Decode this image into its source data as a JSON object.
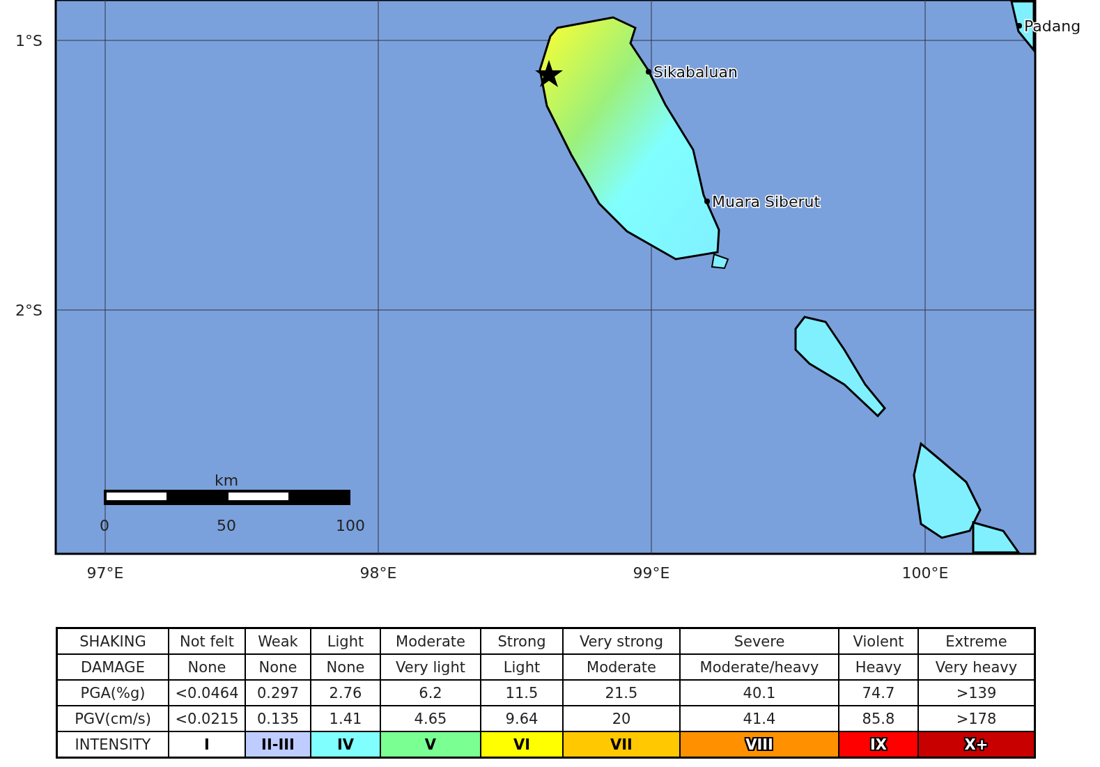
{
  "map": {
    "lat_labels": [
      "1°S",
      "2°S"
    ],
    "lon_labels": [
      "97°E",
      "98°E",
      "99°E",
      "100°E"
    ],
    "cities": [
      {
        "name": "Padang"
      },
      {
        "name": "Sikabaluan"
      },
      {
        "name": "Muara Siberut"
      }
    ],
    "scale_bar": {
      "unit": "km",
      "ticks": [
        "0",
        "50",
        "100"
      ]
    }
  },
  "legend": {
    "rows": [
      {
        "kind": "text",
        "header": "SHAKING",
        "cells": [
          "Not felt",
          "Weak",
          "Light",
          "Moderate",
          "Strong",
          "Very strong",
          "Severe",
          "Violent",
          "Extreme"
        ]
      },
      {
        "kind": "text",
        "header": "DAMAGE",
        "cells": [
          "None",
          "None",
          "None",
          "Very light",
          "Light",
          "Moderate",
          "Moderate/heavy",
          "Heavy",
          "Very heavy"
        ]
      },
      {
        "kind": "text",
        "header": "PGA(%g)",
        "cells": [
          "<0.0464",
          "0.297",
          "2.76",
          "6.2",
          "11.5",
          "21.5",
          "40.1",
          "74.7",
          ">139"
        ]
      },
      {
        "kind": "text",
        "header": "PGV(cm/s)",
        "cells": [
          "<0.0215",
          "0.135",
          "1.41",
          "4.65",
          "9.64",
          "20",
          "41.4",
          "85.8",
          ">178"
        ]
      },
      {
        "kind": "intensity",
        "header": "INTENSITY",
        "cells": [
          {
            "label": "I",
            "color": "#ffffff"
          },
          {
            "label": "II-III",
            "color": "#bfccff"
          },
          {
            "label": "IV",
            "color": "#80ffff"
          },
          {
            "label": "V",
            "color": "#7aff93"
          },
          {
            "label": "VI",
            "color": "#ffff00"
          },
          {
            "label": "VII",
            "color": "#ffc800"
          },
          {
            "label": "VIII",
            "color": "#ff9100"
          },
          {
            "label": "IX",
            "color": "#ff0000"
          },
          {
            "label": "X+",
            "color": "#c80000"
          }
        ]
      }
    ]
  }
}
